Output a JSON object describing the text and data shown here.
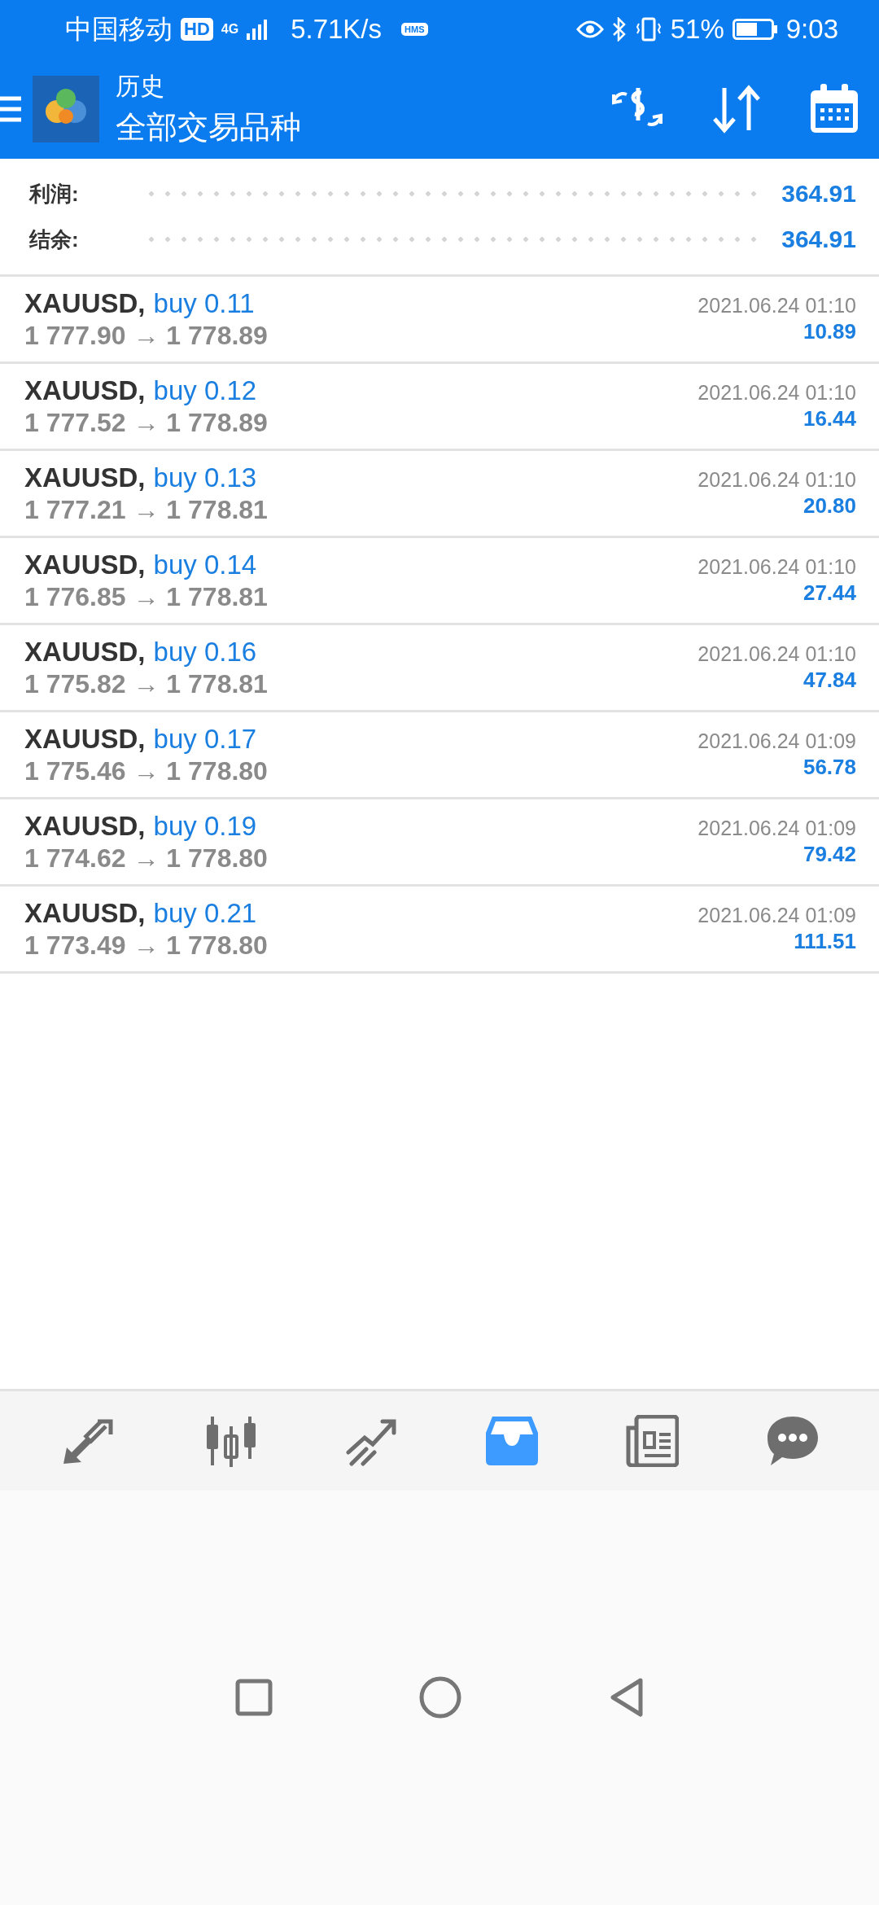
{
  "status_bar": {
    "carrier": "中国移动",
    "hd": "HD",
    "network": "4G",
    "speed": "5.71K/s",
    "hms": "HMS",
    "battery": "51%",
    "time": "9:03"
  },
  "header": {
    "title": "历史",
    "subtitle": "全部交易品种"
  },
  "summary": [
    {
      "label": "利润:",
      "value": "364.91"
    },
    {
      "label": "结余:",
      "value": "364.91"
    }
  ],
  "trades": [
    {
      "symbol": "XAUUSD,",
      "side": "buy 0.11",
      "prices": "1 777.90 → 1 778.89",
      "time": "2021.06.24 01:10",
      "profit": "10.89"
    },
    {
      "symbol": "XAUUSD,",
      "side": "buy 0.12",
      "prices": "1 777.52 → 1 778.89",
      "time": "2021.06.24 01:10",
      "profit": "16.44"
    },
    {
      "symbol": "XAUUSD,",
      "side": "buy 0.13",
      "prices": "1 777.21 → 1 778.81",
      "time": "2021.06.24 01:10",
      "profit": "20.80"
    },
    {
      "symbol": "XAUUSD,",
      "side": "buy 0.14",
      "prices": "1 776.85 → 1 778.81",
      "time": "2021.06.24 01:10",
      "profit": "27.44"
    },
    {
      "symbol": "XAUUSD,",
      "side": "buy 0.16",
      "prices": "1 775.82 → 1 778.81",
      "time": "2021.06.24 01:10",
      "profit": "47.84"
    },
    {
      "symbol": "XAUUSD,",
      "side": "buy 0.17",
      "prices": "1 775.46 → 1 778.80",
      "time": "2021.06.24 01:09",
      "profit": "56.78"
    },
    {
      "symbol": "XAUUSD,",
      "side": "buy 0.19",
      "prices": "1 774.62 → 1 778.80",
      "time": "2021.06.24 01:09",
      "profit": "79.42"
    },
    {
      "symbol": "XAUUSD,",
      "side": "buy 0.21",
      "prices": "1 773.49 → 1 778.80",
      "time": "2021.06.24 01:09",
      "profit": "111.51"
    }
  ],
  "bottom_nav": [
    {
      "selected": false
    },
    {
      "selected": false
    },
    {
      "selected": false
    },
    {
      "selected": true
    },
    {
      "selected": false
    },
    {
      "selected": false
    }
  ]
}
